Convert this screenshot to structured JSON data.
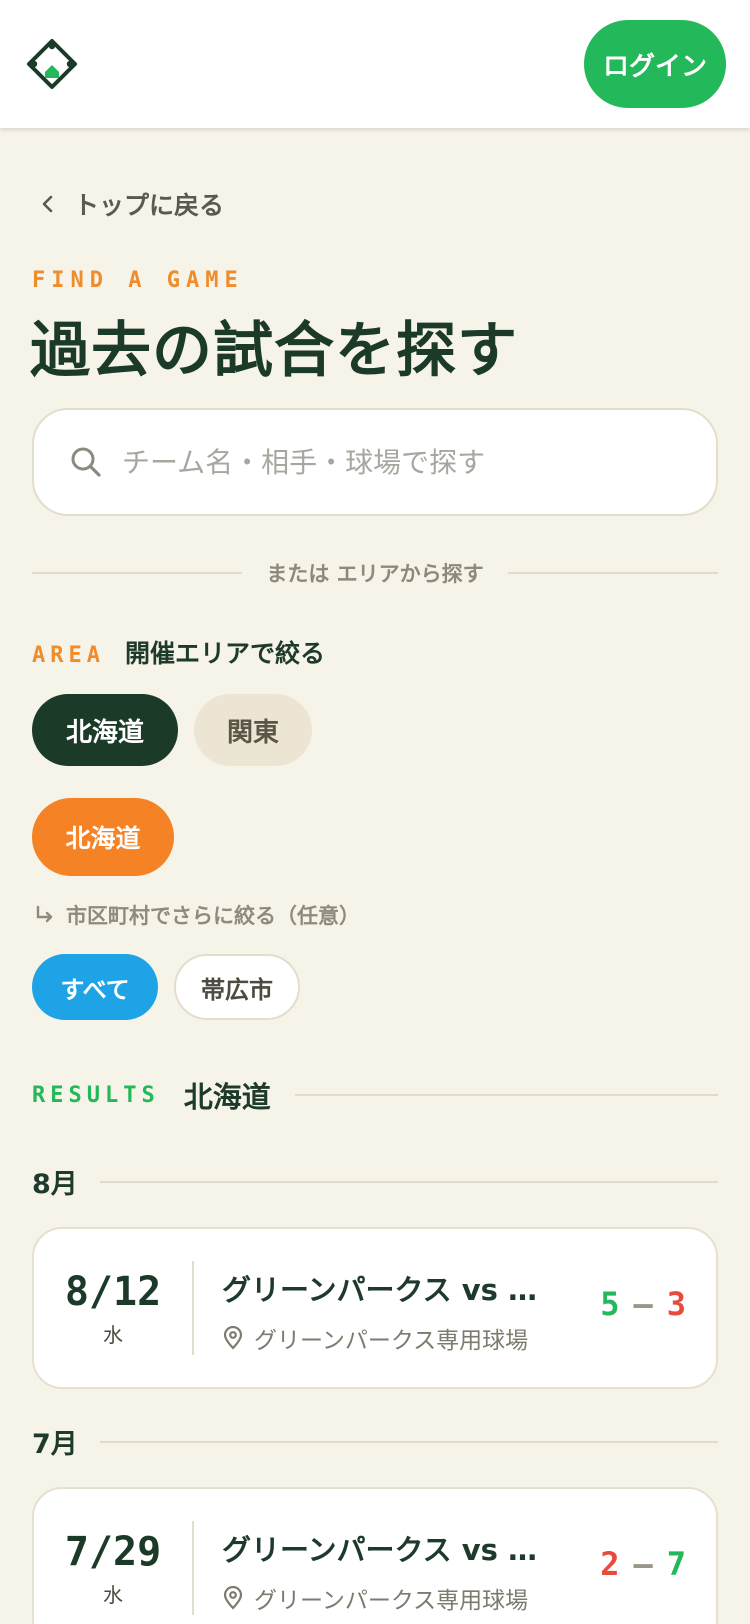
{
  "header": {
    "login_label": "ログイン"
  },
  "back": {
    "label": "トップに戻る"
  },
  "hero": {
    "eyebrow": "FIND A GAME",
    "title": "過去の試合を探す"
  },
  "search": {
    "placeholder": "チーム名・相手・球場で探す",
    "value": ""
  },
  "divider": {
    "text": "または エリアから探す"
  },
  "area": {
    "tag": "AREA",
    "label": "開催エリアで絞る",
    "regions": [
      {
        "label": "北海道",
        "selected": true
      },
      {
        "label": "関東",
        "selected": false
      }
    ],
    "prefecture": {
      "label": "北海道",
      "selected": true
    }
  },
  "city": {
    "hint": "市区町村でさらに絞る（任意）",
    "options": [
      {
        "label": "すべて",
        "selected": true
      },
      {
        "label": "帯広市",
        "selected": false
      }
    ]
  },
  "results": {
    "tag": "RESULTS",
    "value": "北海道",
    "months": [
      {
        "label": "8月",
        "games": [
          {
            "date": "8/12",
            "weekday": "水",
            "title": "グリーンパークス vs レ…",
            "venue": "グリーンパークス専用球場",
            "score_home": "5",
            "score_sep": "–",
            "score_away": "3"
          }
        ]
      },
      {
        "label": "7月",
        "games": [
          {
            "date": "7/29",
            "weekday": "水",
            "title": "グリーンパークス vs ブ…",
            "venue": "グリーンパークス専用球場",
            "score_home": "2",
            "score_sep": "–",
            "score_away": "7"
          }
        ]
      }
    ]
  },
  "colors": {
    "brand_green": "#23b85a",
    "dark_green": "#1b3a28",
    "orange": "#f58224",
    "blue": "#1ea3e6",
    "loss_red": "#e84a3d",
    "background": "#f6f3e9"
  },
  "icons": {
    "logo": "diamond-field-icon",
    "back": "chevron-left-icon",
    "search": "search-icon",
    "sub": "return-arrow-icon",
    "venue": "location-pin-icon"
  }
}
